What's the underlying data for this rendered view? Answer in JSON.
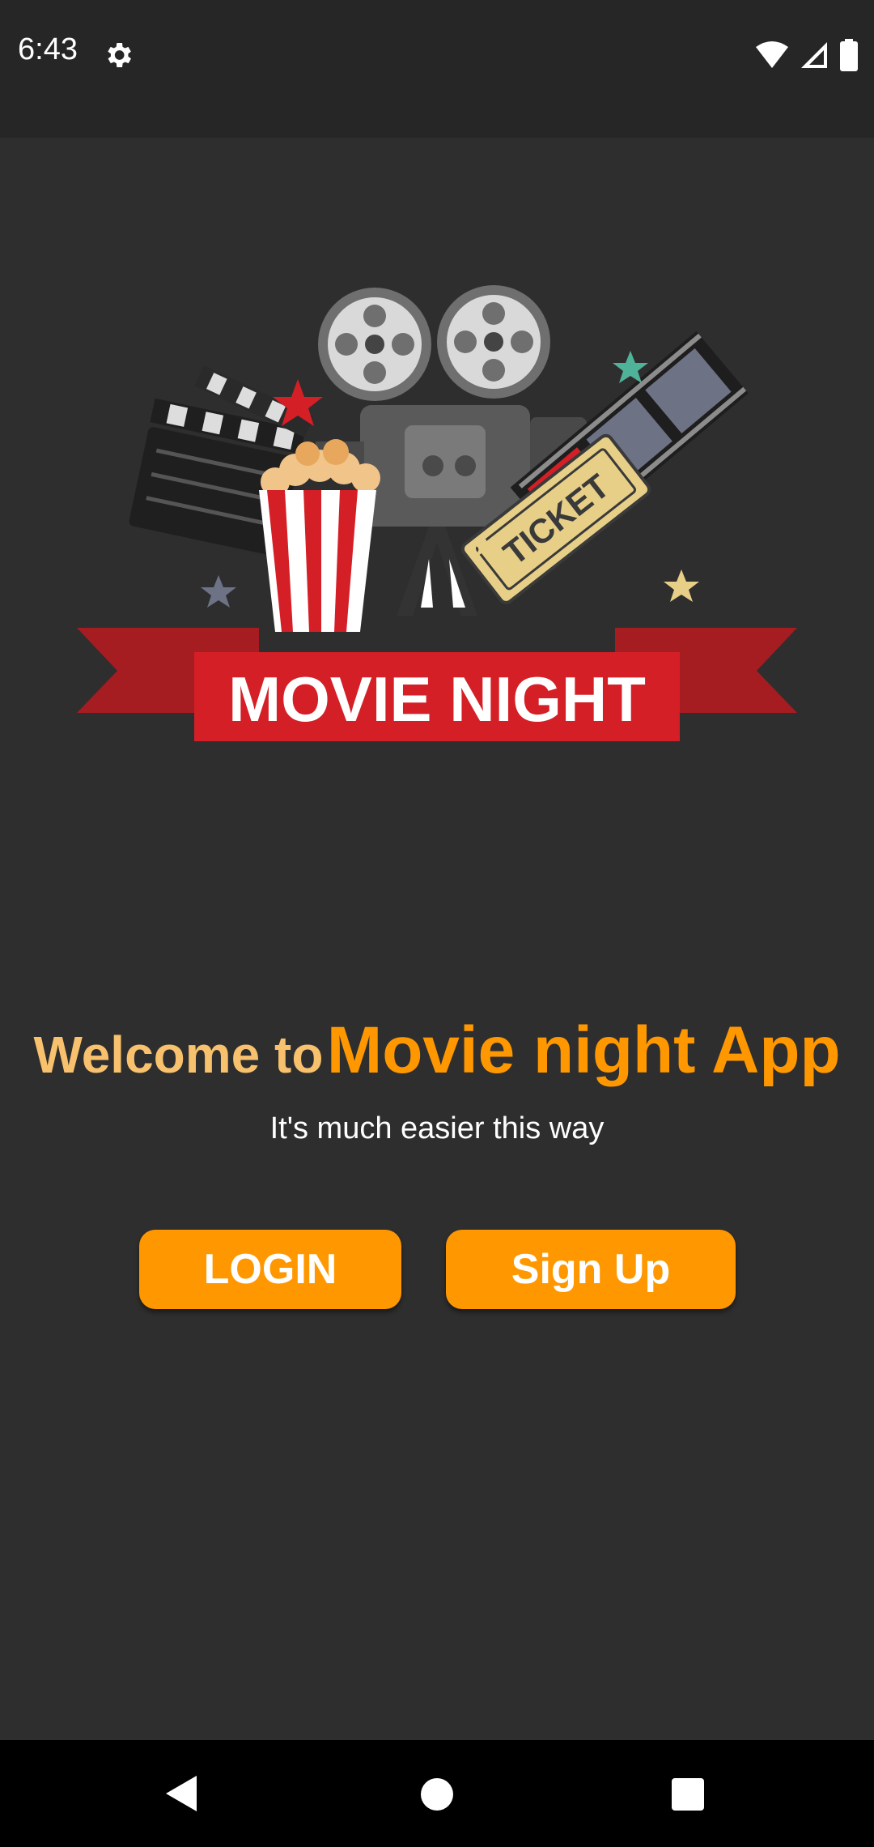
{
  "status_bar": {
    "time": "6:43",
    "icons": [
      "gear-icon",
      "wifi-icon",
      "cell-signal-icon",
      "battery-icon"
    ]
  },
  "logo": {
    "text": "MOVIE NIGHT",
    "ticket_text": "TICKET",
    "icon": "movie-night-logo"
  },
  "welcome": {
    "prefix": "Welcome to",
    "app_name": "Movie night App",
    "tagline": "It's much easier this way"
  },
  "buttons": {
    "login_label": "LOGIN",
    "signup_label": "Sign Up"
  },
  "nav_bar": {
    "icons": [
      "back-icon",
      "home-icon",
      "recents-icon"
    ]
  },
  "colors": {
    "background": "#2f2e2e",
    "accent": "#ff9800",
    "welcome_prefix": "#f7c16e",
    "ribbon": "#d41f26"
  }
}
